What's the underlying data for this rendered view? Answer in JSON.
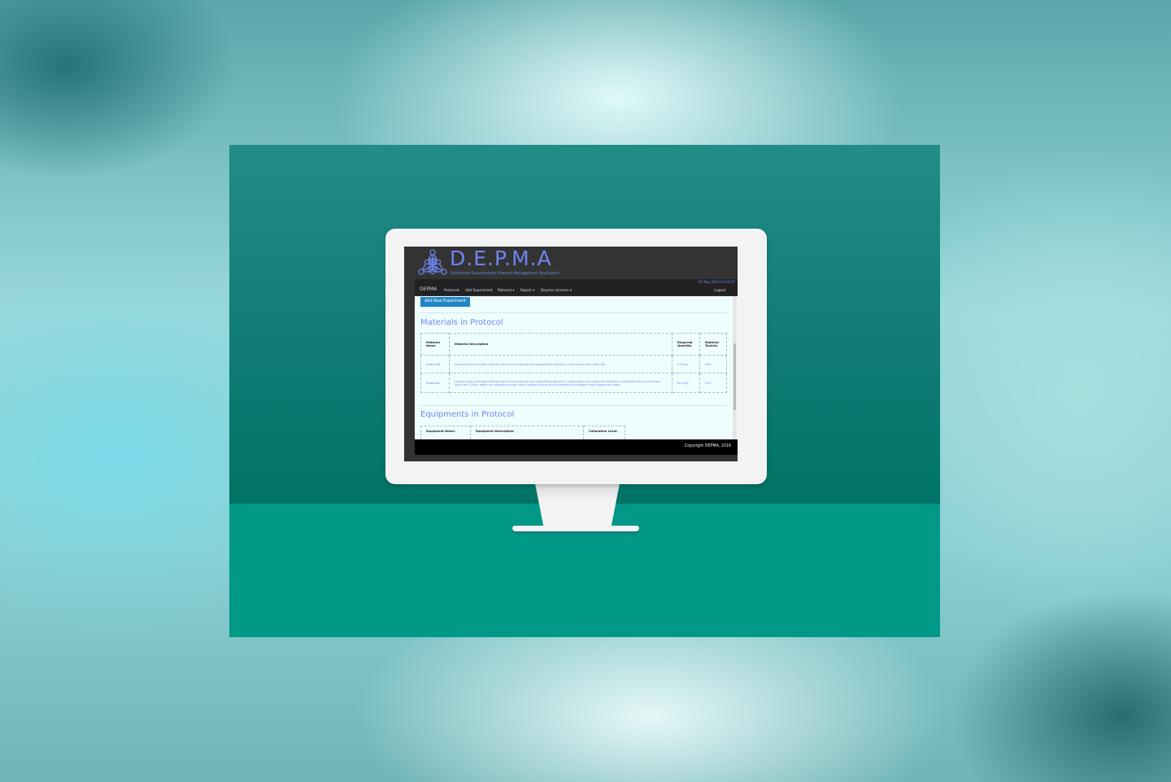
{
  "app": {
    "title": "D.E.P.M.A",
    "subtitle": "Distributed Experimental Protocol Management Application",
    "datetime": "02 May 2016 04:19:07"
  },
  "navbar": {
    "brand": "DEPMA",
    "items": [
      "Protocols",
      "Add Experiment",
      "Material ▾",
      "Report ▾",
      "Depma common ▾"
    ],
    "logout": "Logout"
  },
  "main": {
    "add_button": "Add New Experiment",
    "materials_title": "Materials in Protocol",
    "materials_table": {
      "headers": [
        "Material Name",
        "Material Description",
        "Required Quantity",
        "Material Toxicity"
      ],
      "rows": [
        [
          "materialB",
          "Lorem Ipsum is simply dummy text of the printing and typesetting industry. Lorem Ipsum has been the",
          "23 mcg",
          "34%"
        ],
        [
          "materialC",
          "Lorem Ipsum is simply dummy text of the printing and typesetting industry. Lorem Ipsum has been the industry's standard dummy text ever since the 1500s, when an unknown printer took a galley of type and scrambled it to make a type specimen book.",
          "89 mcg",
          "33%"
        ]
      ]
    },
    "equipments_title": "Equipments in Protocol",
    "equipments_table": {
      "headers": [
        "Equipment Name:",
        "Equipment Description:",
        "Calibration Level:"
      ]
    }
  },
  "footer": {
    "copyright": "Copyright DEPMA, 2016"
  },
  "colors": {
    "accent": "#6f86f0",
    "button": "#1f86c6",
    "wall": "#0f7b74",
    "floor": "#009886"
  }
}
